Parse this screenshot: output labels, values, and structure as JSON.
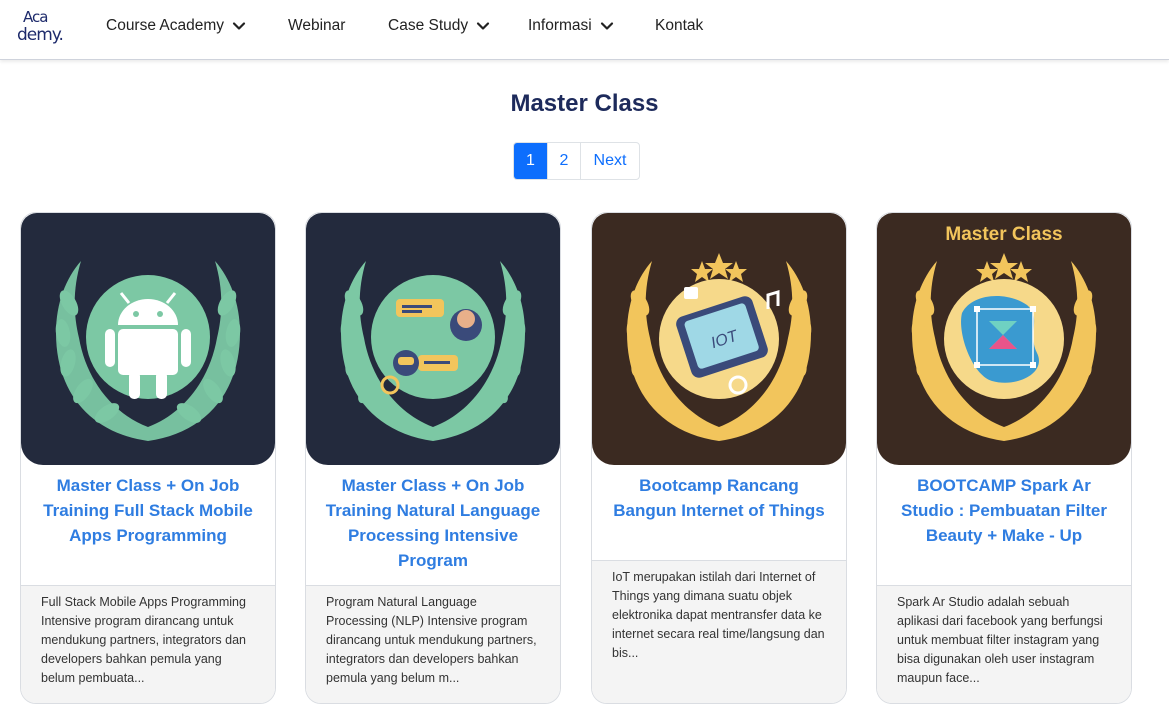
{
  "nav": {
    "logo_line1": "Aca",
    "logo_line2": "demy.",
    "items": [
      {
        "label": "Course Academy",
        "has_dropdown": true
      },
      {
        "label": "Webinar",
        "has_dropdown": false
      },
      {
        "label": "Case Study",
        "has_dropdown": true
      },
      {
        "label": "Informasi",
        "has_dropdown": true
      },
      {
        "label": "Kontak",
        "has_dropdown": false
      }
    ]
  },
  "page": {
    "title": "Master Class"
  },
  "pagination": {
    "pages": [
      "1",
      "2"
    ],
    "next": "Next",
    "active": "1"
  },
  "cards": [
    {
      "image_icon": "android-icon",
      "image_bg": "#232a3d",
      "title": "Master Class + On Job Training Full Stack Mobile Apps Programming",
      "description": "Full Stack Mobile Apps Programming Intensive program dirancang untuk mendukung partners, integrators dan developers bahkan pemula yang belum pembuata..."
    },
    {
      "image_icon": "nlp-chat-icon",
      "image_bg": "#232a3d",
      "title": "Master Class + On Job Training Natural Language Processing Intensive Program",
      "description": "Program Natural Language Processing (NLP) Intensive program dirancang untuk mendukung partners, integrators dan developers bahkan pemula yang belum m..."
    },
    {
      "image_icon": "iot-tablet-icon",
      "image_bg": "#3b2a21",
      "title": "Bootcamp Rancang Bangun Internet of Things",
      "description": "IoT merupakan istilah dari Internet of Things yang dimana suatu objek elektronika dapat mentransfer data ke internet secara real time/langsung dan bis..."
    },
    {
      "image_icon": "spark-ar-icon",
      "image_bg": "#3b2a21",
      "image_caption": "Master Class",
      "title": "BOOTCAMP Spark Ar Studio : Pembuatan Filter Beauty + Make - Up",
      "description": "Spark Ar Studio adalah sebuah aplikasi dari facebook yang berfungsi untuk membuat filter instagram yang bisa digunakan oleh user instagram maupun face..."
    }
  ],
  "colors": {
    "accent": "#0d6efd",
    "card_title": "#2f7de1",
    "heading": "#1d2a5b",
    "laurel_green": "#7cc8a4",
    "laurel_gold": "#f2c55c"
  }
}
